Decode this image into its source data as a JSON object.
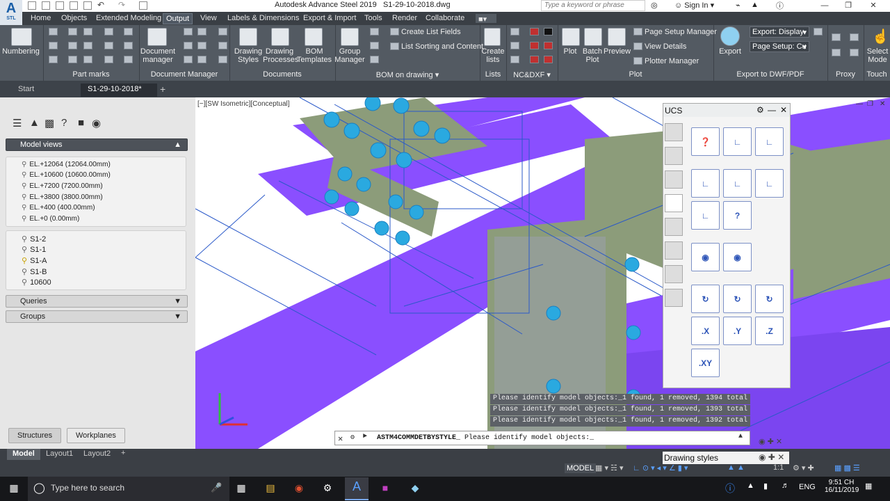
{
  "window": {
    "title": "Autodesk Advance Steel 2019",
    "file": "S1-29-10-2018.dwg",
    "search_placeholder": "Type a keyword or phrase",
    "sign_in": "Sign In"
  },
  "app_logo": {
    "letter": "A",
    "sub": "STL"
  },
  "menu_tabs": [
    "Home",
    "Objects",
    "Extended Modeling",
    "Output",
    "View",
    "Labels & Dimensions",
    "Export & Import",
    "Tools",
    "Render",
    "Collaborate"
  ],
  "active_tab": "Output",
  "ribbon": {
    "numbering": "Numbering",
    "document_manager": "Document manager",
    "drawing_styles": "Drawing Styles",
    "drawing_processes": "Drawing Processes",
    "bom_templates": "BOM Templates",
    "group_manager": "Group Manager",
    "create_list_fields": "Create List Fields",
    "list_sorting": "List Sorting and Content",
    "create_lists": "Create lists",
    "plot": "Plot",
    "batch_plot": "Batch Plot",
    "preview": "Preview",
    "page_setup_manager": "Page Setup Manager",
    "view_details": "View Details",
    "plotter_manager": "Plotter Manager",
    "export": "Export",
    "export_display": "Export: Display",
    "page_setup": "Page Setup: Cu",
    "select_mode": "Select Mode",
    "groups": [
      "Part marks",
      "Document Manager",
      "Documents",
      "BOM on drawing",
      "Lists",
      "NC&DXF",
      "Plot",
      "Export to DWF/PDF",
      "Proxy",
      "Touch"
    ]
  },
  "doc_tabs": [
    "Start",
    "S1-29-10-2018*"
  ],
  "left_panel": {
    "model_views_title": "Model views",
    "elevations": [
      "EL.+12064 (12064.00mm)",
      "EL.+10600 (10600.00mm)",
      "EL.+7200 (7200.00mm)",
      "EL.+3800 (3800.00mm)",
      "EL.+400 (400.00mm)",
      "EL.+0 (0.00mm)"
    ],
    "grids": [
      "S1-2",
      "S1-1",
      "S1-A",
      "S1-B",
      "10600"
    ],
    "queries": "Queries",
    "groups": "Groups",
    "tabs": [
      "Structures",
      "Workplanes"
    ]
  },
  "viewport": {
    "label": "[−][SW Isometric][Conceptual]",
    "history": [
      "Please identify model objects:_1 found, 1 removed, 1394 total",
      "Please identify model objects:_1 found, 1 removed, 1393 total",
      "Please identify model objects:_1 found, 1 removed, 1392 total"
    ],
    "command_name": "ASTM4COMMDETBYSTYLE_",
    "command_prompt": "Please identify model objects:_"
  },
  "ucs": {
    "title": "UCS",
    "buttons": [
      ".X",
      ".Y",
      ".Z",
      ".XY"
    ]
  },
  "drawing_styles_palette": "Drawing styles",
  "layout_tabs": [
    "Model",
    "Layout1",
    "Layout2"
  ],
  "status": {
    "model": "MODEL",
    "scale": "1:1"
  },
  "taskbar": {
    "search": "Type here to search",
    "lang": "ENG",
    "time": "9:51 CH",
    "date": "16/11/2019"
  },
  "colors": {
    "beam": "#8a4fff",
    "plate": "#8c9c7a",
    "bolt": "#2aa9e0",
    "wire": "#2a59c9",
    "ucs_accent": "#2e55b8"
  },
  "icons": [
    "gear-icon",
    "bell-icon",
    "cross-icon",
    "close-icon",
    "minimize-icon",
    "restore-icon",
    "search-icon",
    "pin-icon"
  ]
}
